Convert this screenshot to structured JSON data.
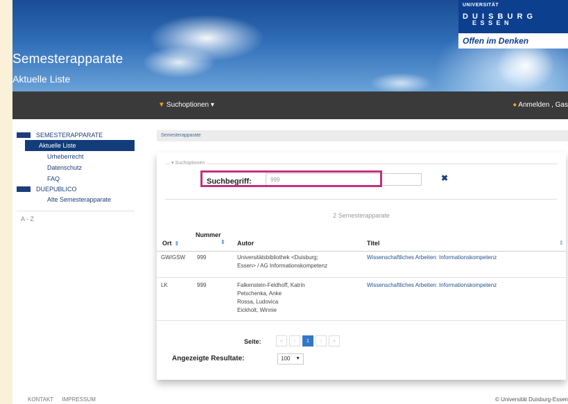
{
  "header": {
    "title": "Semesterapparate",
    "subtitle": "Aktuelle Liste",
    "logo_top": "UNIVERSITÄT",
    "logo_line1": "D U I S B U R G",
    "logo_line2": "E S S E N",
    "motto": "Offen im Denken"
  },
  "navbar": {
    "search_options": "Suchoptionen ▾",
    "login": "Anmelden , Gas"
  },
  "sidebar": {
    "section1": "SEMESTERAPPARATE",
    "items1": [
      "Aktuelle Liste",
      "Urheberrecht",
      "Datenschutz",
      "FAQ"
    ],
    "section2": "DUEPUBLICO",
    "items2": [
      "Alte Semesterapparate"
    ],
    "az": "A - Z"
  },
  "breadcrumb": "Semesterapparate",
  "search": {
    "legend": "▾ Suchoptionen",
    "label": "Suchbegriff:",
    "value": "999",
    "clear": "✖"
  },
  "results": {
    "count": "2 Semesterapparate",
    "headers": {
      "ort": "Ort",
      "nummer": "Nummer",
      "autor": "Autor",
      "titel": "Titel"
    },
    "rows": [
      {
        "ort": "GW/GSW",
        "nummer": "999",
        "autor": [
          "Universitätsbibliothek <Duisburg;",
          "Essen> / AG Informationskompetenz"
        ],
        "titel": "Wissenschaftliches Arbeiten: Informationskompetenz"
      },
      {
        "ort": "LK",
        "nummer": "999",
        "autor": [
          "Falkenstein-Feldhoff, Katrin",
          "Petschenka, Anke",
          "Rossa, Ludovica",
          "Eickholt, Winnie"
        ],
        "titel": "Wissenschaftliches Arbeiten: Informationskompetenz"
      }
    ]
  },
  "pagination": {
    "label": "Seite:",
    "first": "«",
    "prev": "‹",
    "current": "1",
    "next": "›",
    "last": "»",
    "per_page_label": "Angezeigte Resultate:",
    "per_page_value": "100"
  },
  "footer": {
    "contact": "KONTAKT",
    "imprint": "IMPRESSUM",
    "copyright": "© Universität Duisburg-Essen"
  },
  "colors": {
    "highlight": "#c2307a",
    "nav_bg": "#3a3a3a",
    "link": "#23508f",
    "accent": "#f0a020"
  }
}
